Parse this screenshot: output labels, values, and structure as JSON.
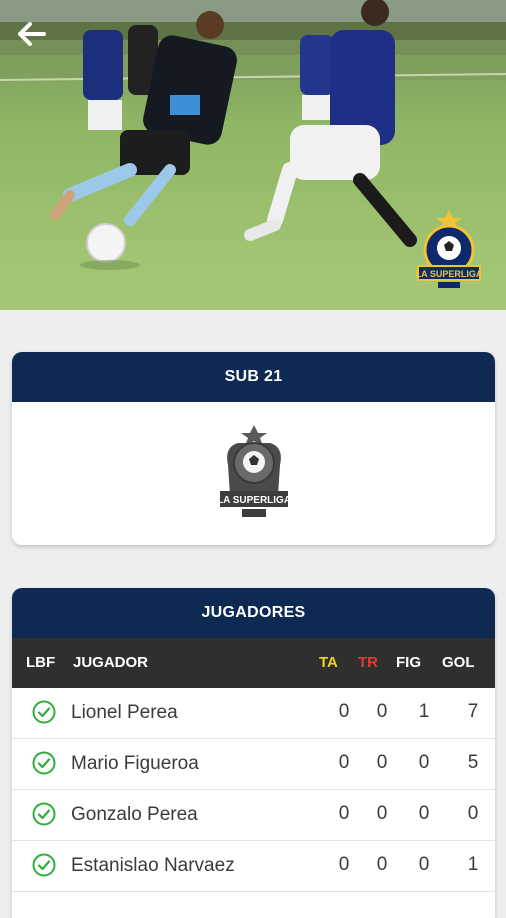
{
  "team": {
    "category": "SUB 21",
    "logo_text": "LA SUPERLIGA"
  },
  "hero": {
    "logo_text": "LA SUPERLIGA"
  },
  "players": {
    "title": "JUGADORES",
    "columns": {
      "lbf": "LBF",
      "player": "JUGADOR",
      "ta": "TA",
      "tr": "TR",
      "fig": "FIG",
      "gol": "GOL"
    },
    "rows": [
      {
        "name": "Lionel Perea",
        "ta": "0",
        "tr": "0",
        "fig": "1",
        "gol": "7"
      },
      {
        "name": "Mario Figueroa",
        "ta": "0",
        "tr": "0",
        "fig": "0",
        "gol": "5"
      },
      {
        "name": "Gonzalo Perea",
        "ta": "0",
        "tr": "0",
        "fig": "0",
        "gol": "0"
      },
      {
        "name": "Estanislao Narvaez",
        "ta": "0",
        "tr": "0",
        "fig": "0",
        "gol": "1"
      }
    ]
  },
  "colors": {
    "header_navy": "#0f2a52",
    "table_header": "#2f2f2f",
    "ta_yellow": "#f2d21b",
    "tr_red": "#e53935",
    "check_green": "#2fae3b"
  },
  "icons": {
    "back": "arrow-left-icon",
    "check": "check-circle-icon"
  }
}
